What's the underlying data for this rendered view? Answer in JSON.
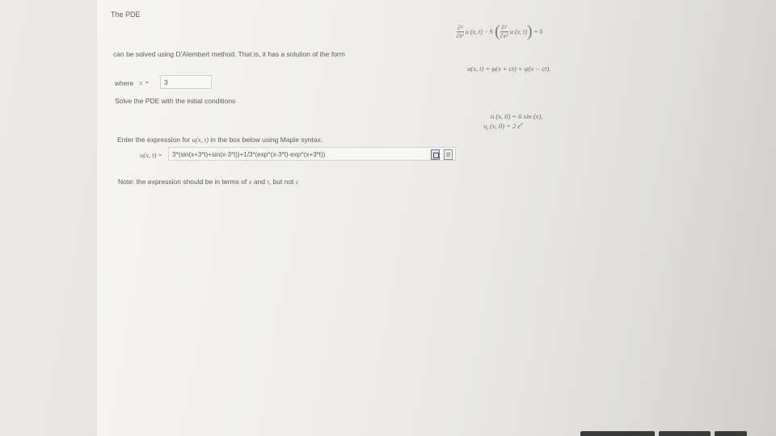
{
  "question": {
    "title": "The PDE",
    "pde": {
      "lhs_num": "∂²",
      "lhs_den": "∂t²",
      "u_term": "u (x, t)",
      "coef": "− 9",
      "rhs_num": "∂²",
      "rhs_den": "∂x²",
      "equals": "= 0"
    },
    "solution_text": "can be solved using D'Alembert method. That is, it has a solution of the form",
    "solution_form": "u(x, t) = φ(x + ct) + ψ(x − ct).",
    "where_label": "where",
    "c_label": "c =",
    "c_value": "3",
    "solve_text": "Solve the PDE with the initial conditions",
    "ic1": "u (x, 0) = 6 sin (x),",
    "ic2": "u",
    "ic2_sub": "t",
    "ic2_rest": "(x, 0) = 2 e",
    "ic2_sup": "x",
    "enter_text_pre": "Enter the expression for",
    "enter_text_math": "u(x, t)",
    "enter_text_post": "in the box below using Maple syntax.",
    "answer_label": "u(x, t) =",
    "answer_value": "3*(sin(x+3*t)+sin(x-3*t))+1/3*(exp^(x-3*t)-exp^(x+3*t))",
    "note_pre": "Note: the expression should be in terms of",
    "note_x": "x",
    "note_and": "and",
    "note_t": "t",
    "note_but": ", but not",
    "note_c": "c"
  }
}
